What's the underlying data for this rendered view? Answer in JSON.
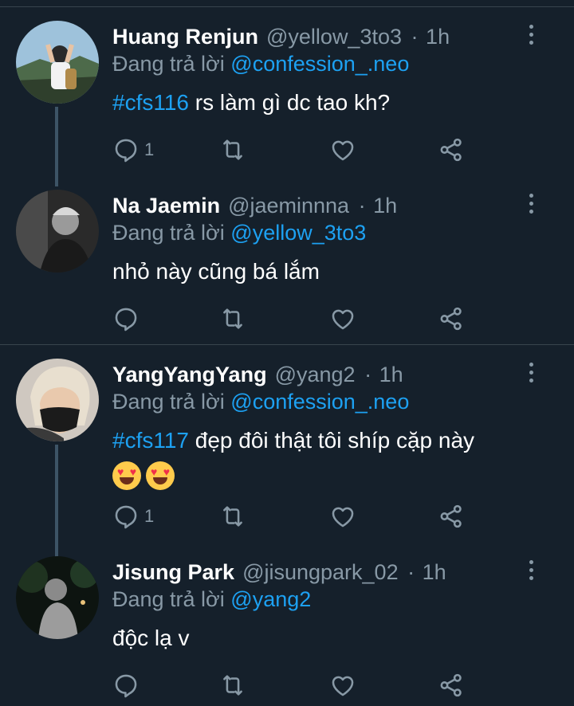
{
  "replying_prefix": "Đang trả lời",
  "tweets": [
    {
      "name": "Huang Renjun",
      "handle": "@yellow_3to3",
      "sep": "·",
      "time": "1h",
      "reply_to": "@confession_.neo",
      "hashtag": "#cfs116",
      "text": " rs làm gì dc tao kh?",
      "reply_count": "1"
    },
    {
      "name": "Na Jaemin",
      "handle": "@jaeminnna",
      "sep": "·",
      "time": "1h",
      "reply_to": "@yellow_3to3",
      "text": "nhỏ này cũng bá lắm",
      "reply_count": ""
    },
    {
      "name": "YangYangYang",
      "handle": "@yang2",
      "sep": "·",
      "time": "1h",
      "reply_to": "@confession_.neo",
      "hashtag": "#cfs117",
      "text": " đẹp đôi thật tôi shíp cặp này",
      "emoji": "heart-eyes-emoji",
      "reply_count": "1"
    },
    {
      "name": "Jisung Park",
      "handle": "@jisungpark_02",
      "sep": "·",
      "time": "1h",
      "reply_to": "@yang2",
      "text": "độc lạ v",
      "reply_count": ""
    }
  ],
  "icons": [
    "reply-icon",
    "retweet-icon",
    "like-icon",
    "share-icon",
    "more-options-icon"
  ],
  "colors": {
    "background": "#15202b",
    "accent": "#1da1f2",
    "secondary_text": "#8899a6",
    "divider": "#38444d"
  }
}
